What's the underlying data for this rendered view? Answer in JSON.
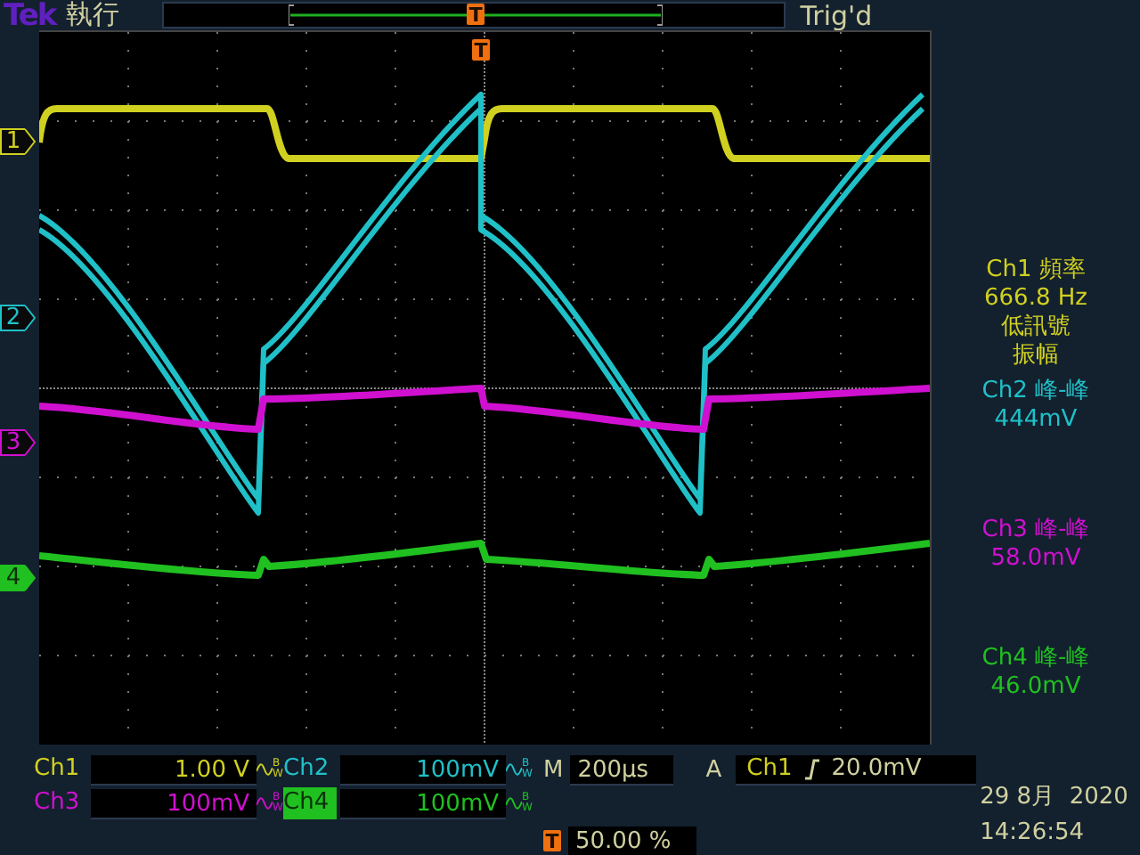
{
  "top_bar": {
    "brand": "Tek",
    "run_state": "執行",
    "record_marker": "T",
    "trigger_status": "Trig'd"
  },
  "trigger_point_marker": "T",
  "channels": [
    {
      "name": "Ch1",
      "marker": "1",
      "color": "#d0d020",
      "selected": false,
      "scale": "1.00 V",
      "bandwidth": "BW"
    },
    {
      "name": "Ch2",
      "marker": "2",
      "color": "#20c0c8",
      "selected": false,
      "scale": "100mV",
      "bandwidth": "BW"
    },
    {
      "name": "Ch3",
      "marker": "3",
      "color": "#d010d0",
      "selected": false,
      "scale": "100mV",
      "bandwidth": "BW"
    },
    {
      "name": "Ch4",
      "marker": "4",
      "color": "#20c020",
      "selected": true,
      "scale": "100mV",
      "bandwidth": "BW"
    }
  ],
  "measurements": [
    {
      "color": "#d0d020",
      "lines": [
        "Ch1 頻率",
        "666.8 Hz",
        "低訊號",
        "振幅"
      ]
    },
    {
      "color": "#20c0c8",
      "lines": [
        "Ch2 峰-峰",
        "444mV"
      ]
    },
    {
      "color": "#d010d0",
      "lines": [
        "Ch3 峰-峰",
        "58.0mV"
      ]
    },
    {
      "color": "#20c020",
      "lines": [
        "Ch4 峰-峰",
        "46.0mV"
      ]
    }
  ],
  "timebase": {
    "label": "M",
    "value": "200µs"
  },
  "trigger": {
    "label": "A",
    "source": "Ch1",
    "level": "20.0mV"
  },
  "trigger_position": {
    "marker": "T",
    "value": "50.00 %"
  },
  "date": "29 8月  2020",
  "time": "14:26:54"
}
